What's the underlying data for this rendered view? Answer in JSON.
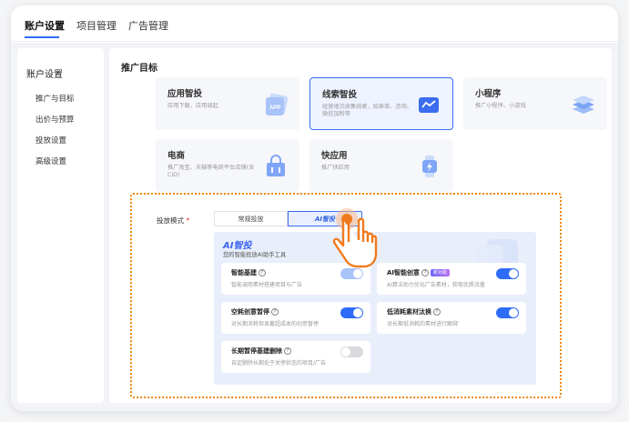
{
  "header": {
    "tabs": [
      {
        "label": "账户设置",
        "active": true
      },
      {
        "label": "项目管理",
        "active": false
      },
      {
        "label": "广告管理",
        "active": false
      }
    ]
  },
  "sidebar": {
    "title": "账户设置",
    "items": [
      {
        "label": "推广与目标"
      },
      {
        "label": "出价与预算"
      },
      {
        "label": "投放设置"
      },
      {
        "label": "高级设置"
      }
    ]
  },
  "main": {
    "title": "推广目标",
    "cards": [
      {
        "title": "应用智投",
        "desc": "应用下载、应用调起",
        "icon": "app-icon",
        "selected": false
      },
      {
        "title": "线索智投",
        "desc": "经营地沉收集线索，如表单、咨询、微信加粉等",
        "icon": "chart-icon",
        "selected": true
      },
      {
        "title": "小程序",
        "desc": "推广小程序、小游戏",
        "icon": "layers-icon",
        "selected": false
      },
      {
        "title": "电商",
        "desc": "推广淘宝、天猫等电商平台店铺(含CID)",
        "icon": "shop-icon",
        "selected": false
      },
      {
        "title": "快应用",
        "desc": "推广快应用",
        "icon": "watch-icon",
        "selected": false
      }
    ]
  },
  "mode": {
    "label": "投放模式",
    "required_mark": "*",
    "options": [
      "常规投放",
      "AI智投"
    ],
    "selected": "AI智投"
  },
  "ai_panel": {
    "title": "AI智投",
    "subtitle": "您的智能投放AI助手工具",
    "options": [
      {
        "title": "智能基建",
        "desc": "智能调用素材搭建项目与广告",
        "state": "on-light",
        "badge": ""
      },
      {
        "title": "AI智能创意",
        "desc": "AI算法助力优化广告素材，获取优质流量",
        "state": "on",
        "badge": "新功能"
      },
      {
        "title": "空耗创意暂停",
        "desc": "对长期消耗但显著超成本的创意暂停",
        "state": "on",
        "badge": ""
      },
      {
        "title": "低消耗素材汰换",
        "desc": "对长期低消耗的素材进行解绑",
        "state": "on",
        "badge": ""
      },
      {
        "title": "长期暂停基建删除",
        "desc": "自定删除长期处于关停状态的项目/广告",
        "state": "off",
        "badge": ""
      }
    ]
  },
  "colors": {
    "accent": "#2d6cf6",
    "highlight_border": "#f0870f",
    "hand": "#f07b1e"
  }
}
